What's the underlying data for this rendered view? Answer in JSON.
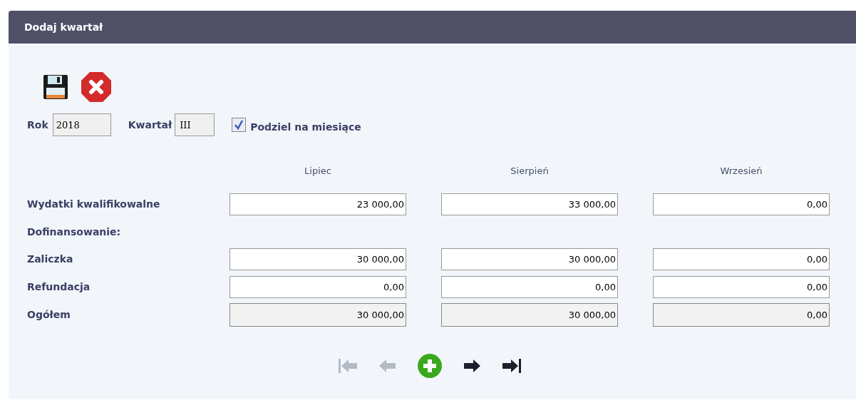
{
  "window": {
    "title": "Dodaj kwartał"
  },
  "toolbar": [
    {
      "kind": "save"
    },
    {
      "kind": "cancel"
    }
  ],
  "filters": {
    "year_label": "Rok",
    "year": "2018",
    "quarter_label": "Kwartał",
    "quarter": "III",
    "split": {
      "label": "Podziel na miesiące",
      "checked": true
    }
  },
  "table": {
    "columns": [
      "Lipiec",
      "Sierpień",
      "Wrzesień"
    ],
    "rows": [
      {
        "kind": "input",
        "label": "Wydatki kwalifikowalne",
        "values": [
          "23 000,00",
          "33 000,00",
          "0,00"
        ]
      },
      {
        "kind": "section",
        "label": "Dofinansowanie:"
      },
      {
        "kind": "input",
        "label": "Zaliczka",
        "values": [
          "30 000,00",
          "30 000,00",
          "0,00"
        ]
      },
      {
        "kind": "input",
        "label": "Refundacja",
        "values": [
          "0,00",
          "0,00",
          "0,00"
        ]
      },
      {
        "kind": "total",
        "label": "Ogółem",
        "values": [
          "30 000,00",
          "30 000,00",
          "0,00"
        ]
      }
    ]
  },
  "navigation": [
    {
      "kind": "first",
      "disabled": true
    },
    {
      "kind": "prev",
      "disabled": true
    },
    {
      "kind": "add",
      "disabled": false
    },
    {
      "kind": "next",
      "disabled": false
    },
    {
      "kind": "last",
      "disabled": false
    }
  ]
}
